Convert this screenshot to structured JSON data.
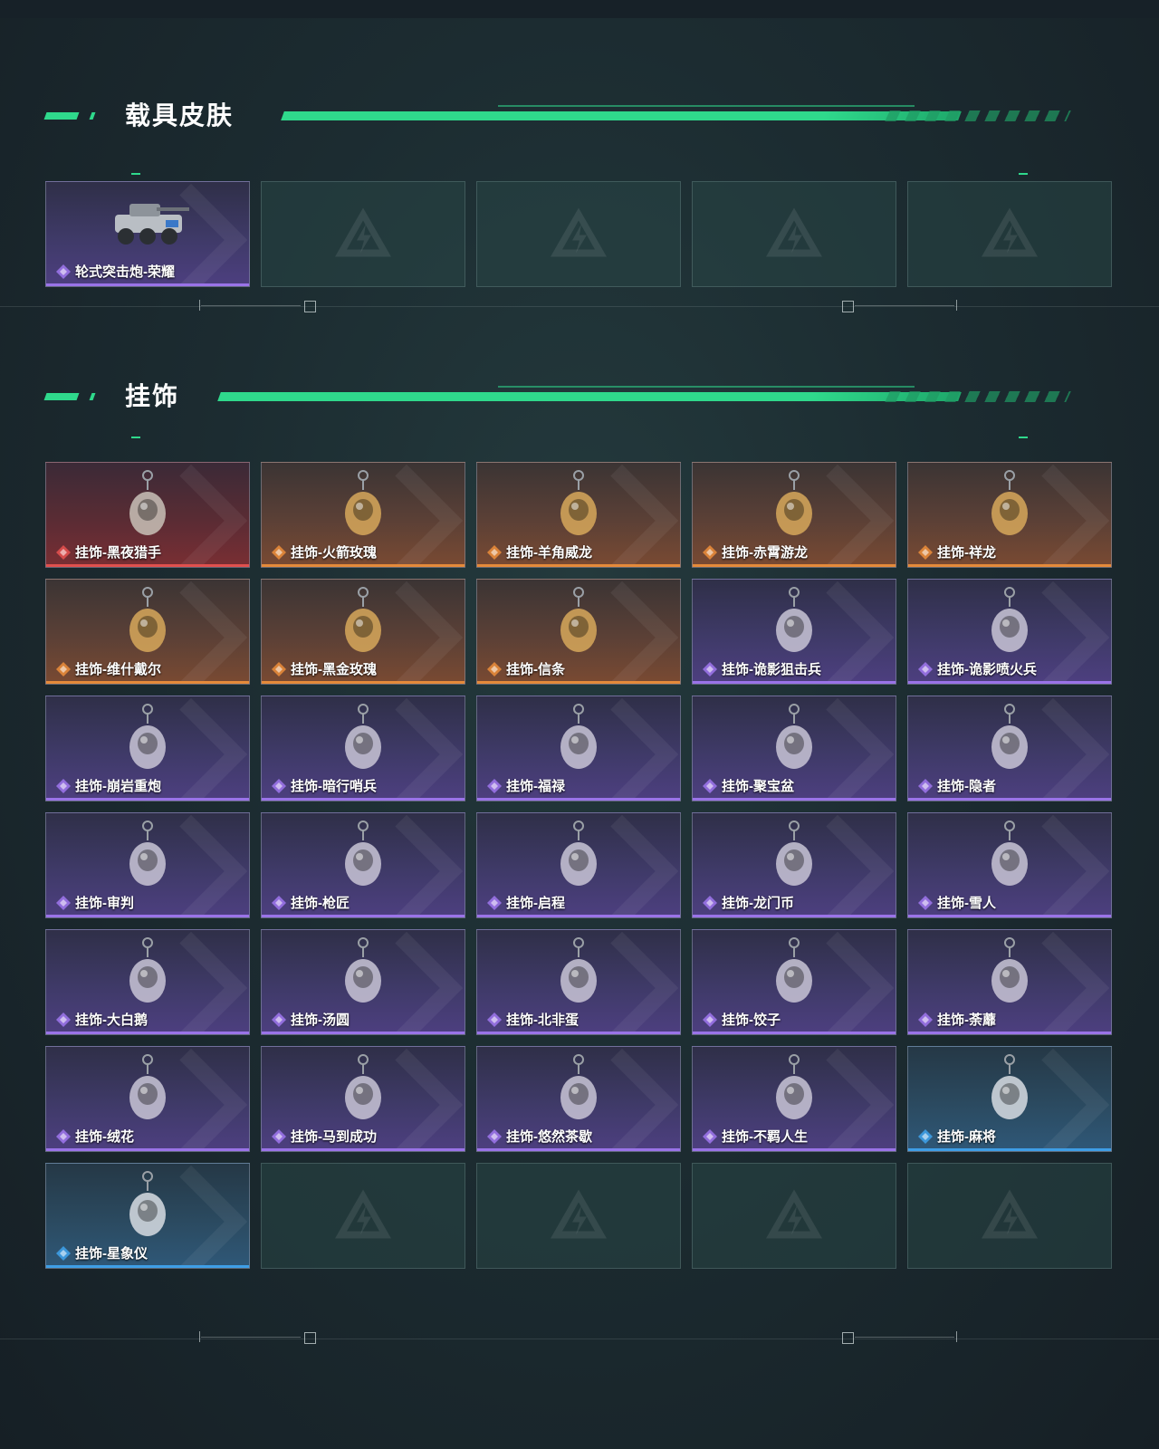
{
  "sections": {
    "vehicle": {
      "title": "载具皮肤",
      "items": [
        {
          "name": "轮式突击炮-荣耀",
          "rarity": "purple",
          "icon": "armored-vehicle-icon"
        },
        {
          "empty": true
        },
        {
          "empty": true
        },
        {
          "empty": true
        },
        {
          "empty": true
        }
      ]
    },
    "charms": {
      "title": "挂饰",
      "items": [
        {
          "name": "挂饰-黑夜猎手",
          "rarity": "red",
          "icon": "white-creature-charm-icon"
        },
        {
          "name": "挂饰-火箭玫瑰",
          "rarity": "orange",
          "icon": "helmet-charm-icon"
        },
        {
          "name": "挂饰-羊角威龙",
          "rarity": "orange",
          "icon": "red-helmet-charm-icon"
        },
        {
          "name": "挂饰-赤霄游龙",
          "rarity": "orange",
          "icon": "dragon-figure-charm-icon"
        },
        {
          "name": "挂饰-祥龙",
          "rarity": "orange",
          "icon": "jade-dragon-charm-icon"
        },
        {
          "name": "挂饰-维什戴尔",
          "rarity": "orange",
          "icon": "red-card-charm-icon"
        },
        {
          "name": "挂饰-黑金玫瑰",
          "rarity": "orange",
          "icon": "black-rose-charm-icon"
        },
        {
          "name": "挂饰-信条",
          "rarity": "orange",
          "icon": "metal-figure-charm-icon"
        },
        {
          "name": "挂饰-诡影狙击兵",
          "rarity": "purple",
          "icon": "sniper-mask-charm-icon"
        },
        {
          "name": "挂饰-诡影喷火兵",
          "rarity": "purple",
          "icon": "flamethrower-charm-icon"
        },
        {
          "name": "挂饰-崩岩重炮",
          "rarity": "purple",
          "icon": "heavy-gunner-charm-icon"
        },
        {
          "name": "挂饰-暗行哨兵",
          "rarity": "purple",
          "icon": "sentinel-charm-icon"
        },
        {
          "name": "挂饰-福禄",
          "rarity": "purple",
          "icon": "gourd-charm-icon"
        },
        {
          "name": "挂饰-聚宝盆",
          "rarity": "purple",
          "icon": "treasure-bowl-charm-icon"
        },
        {
          "name": "挂饰-隐者",
          "rarity": "purple",
          "icon": "tarot-card-charm-icon"
        },
        {
          "name": "挂饰-审判",
          "rarity": "purple",
          "icon": "judgement-card-charm-icon"
        },
        {
          "name": "挂饰-枪匠",
          "rarity": "purple",
          "icon": "gun-crate-charm-icon"
        },
        {
          "name": "挂饰-启程",
          "rarity": "purple",
          "icon": "emblem-charm-icon"
        },
        {
          "name": "挂饰-龙门币",
          "rarity": "purple",
          "icon": "coin-tag-charm-icon"
        },
        {
          "name": "挂饰-雪人",
          "rarity": "purple",
          "icon": "snowman-charm-icon"
        },
        {
          "name": "挂饰-大白鹅",
          "rarity": "purple",
          "icon": "goose-charm-icon"
        },
        {
          "name": "挂饰-汤圆",
          "rarity": "purple",
          "icon": "tangyuan-bowl-charm-icon"
        },
        {
          "name": "挂饰-北非蛋",
          "rarity": "purple",
          "icon": "shakshuka-charm-icon"
        },
        {
          "name": "挂饰-饺子",
          "rarity": "purple",
          "icon": "dumpling-plate-charm-icon"
        },
        {
          "name": "挂饰-荼蘼",
          "rarity": "purple",
          "icon": "white-flower-charm-icon"
        },
        {
          "name": "挂饰-绒花",
          "rarity": "purple",
          "icon": "red-flower-charm-icon"
        },
        {
          "name": "挂饰-马到成功",
          "rarity": "purple",
          "icon": "red-horse-charm-icon"
        },
        {
          "name": "挂饰-悠然茶歇",
          "rarity": "purple",
          "icon": "cupcake-charm-icon"
        },
        {
          "name": "挂饰-不羁人生",
          "rarity": "purple",
          "icon": "sneaker-charm-icon"
        },
        {
          "name": "挂饰-麻将",
          "rarity": "blue",
          "icon": "mahjong-tile-charm-icon"
        },
        {
          "name": "挂饰-星象仪",
          "rarity": "blue",
          "icon": "astrolabe-charm-icon"
        },
        {
          "empty": true
        },
        {
          "empty": true
        },
        {
          "empty": true
        },
        {
          "empty": true
        }
      ]
    }
  },
  "colors": {
    "accent": "#2fd98c",
    "red": "#e0504e",
    "orange": "#e58a3a",
    "purple": "#9a73e8",
    "blue": "#3e9ee6"
  }
}
